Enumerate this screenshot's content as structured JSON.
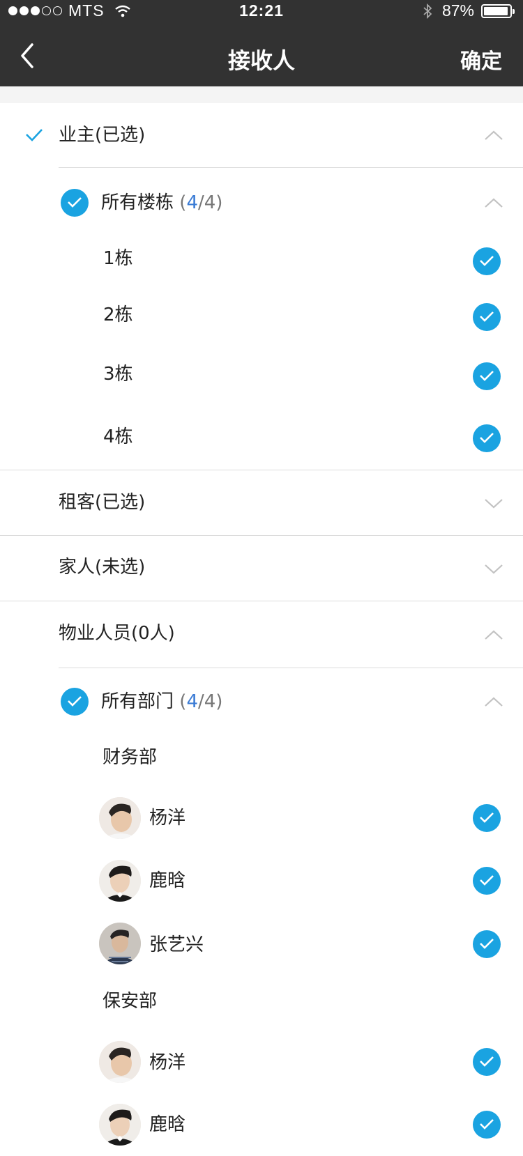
{
  "status_bar": {
    "carrier": "MTS",
    "time": "12:21",
    "battery": "87%"
  },
  "nav": {
    "title": "接收人",
    "confirm": "确定"
  },
  "groups": {
    "owner": {
      "label": "业主(已选)",
      "sub": {
        "label": "所有楼栋",
        "count_open": "(",
        "count_selected": "4",
        "count_rest": "/4)"
      },
      "items": [
        "1栋",
        "2栋",
        "3栋",
        "4栋"
      ]
    },
    "tenant": {
      "label": "租客(已选)"
    },
    "family": {
      "label": "家人(未选)"
    },
    "staff": {
      "label": "物业人员(0人)",
      "sub": {
        "label": "所有部门",
        "count_open": "(",
        "count_selected": "4",
        "count_rest": "/4)"
      },
      "departments": [
        {
          "name": "财务部",
          "people": [
            "杨洋",
            "鹿晗",
            "张艺兴"
          ]
        },
        {
          "name": "保安部",
          "people": [
            "杨洋",
            "鹿晗"
          ]
        }
      ]
    }
  },
  "colors": {
    "accent": "#1aa3e1",
    "navbar": "#323232",
    "count_selected": "#3a7bd5"
  }
}
